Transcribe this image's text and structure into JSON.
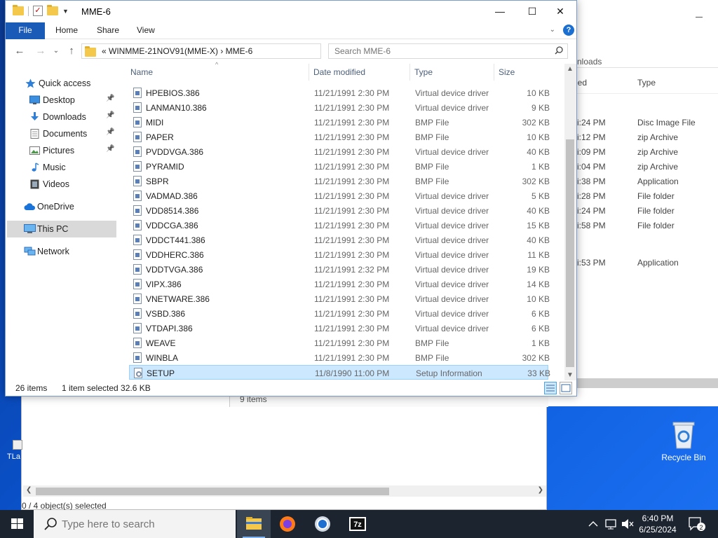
{
  "window": {
    "title": "MME-6",
    "controls": {
      "minimize": "—",
      "maximize": "☐",
      "close": "✕"
    }
  },
  "ribbon": {
    "tabs": [
      "File",
      "Home",
      "Share",
      "View"
    ],
    "help": "?"
  },
  "nav": {
    "back": "←",
    "forward": "→",
    "recent": "⌄",
    "up": "↑",
    "breadcrumb": "«  WINMME-21NOV91(MME-X)  ›  MME-6",
    "refresh": "↻",
    "search_placeholder": "Search MME-6"
  },
  "navpane": {
    "items": [
      {
        "label": "Quick access",
        "icon": "star-icon"
      },
      {
        "label": "Desktop",
        "icon": "desktop-icon",
        "pinned": true
      },
      {
        "label": "Downloads",
        "icon": "download-icon",
        "pinned": true
      },
      {
        "label": "Documents",
        "icon": "documents-icon",
        "pinned": true
      },
      {
        "label": "Pictures",
        "icon": "pictures-icon",
        "pinned": true
      },
      {
        "label": "Music",
        "icon": "music-icon"
      },
      {
        "label": "Videos",
        "icon": "videos-icon"
      },
      {
        "label": "OneDrive",
        "icon": "cloud-icon"
      },
      {
        "label": "This PC",
        "icon": "computer-icon",
        "selected": true
      },
      {
        "label": "Network",
        "icon": "network-icon"
      }
    ]
  },
  "columns": {
    "name": "Name",
    "date": "Date modified",
    "type": "Type",
    "size": "Size"
  },
  "files": [
    {
      "name": "HPEBIOS.386",
      "date": "11/21/1991 2:30 PM",
      "type": "Virtual device driver",
      "size": "10 KB"
    },
    {
      "name": "LANMAN10.386",
      "date": "11/21/1991 2:30 PM",
      "type": "Virtual device driver",
      "size": "9 KB"
    },
    {
      "name": "MIDI",
      "date": "11/21/1991 2:30 PM",
      "type": "BMP File",
      "size": "302 KB"
    },
    {
      "name": "PAPER",
      "date": "11/21/1991 2:30 PM",
      "type": "BMP File",
      "size": "10 KB"
    },
    {
      "name": "PVDDVGA.386",
      "date": "11/21/1991 2:30 PM",
      "type": "Virtual device driver",
      "size": "40 KB"
    },
    {
      "name": "PYRAMID",
      "date": "11/21/1991 2:30 PM",
      "type": "BMP File",
      "size": "1 KB"
    },
    {
      "name": "SBPR",
      "date": "11/21/1991 2:30 PM",
      "type": "BMP File",
      "size": "302 KB"
    },
    {
      "name": "VADMAD.386",
      "date": "11/21/1991 2:30 PM",
      "type": "Virtual device driver",
      "size": "5 KB"
    },
    {
      "name": "VDD8514.386",
      "date": "11/21/1991 2:30 PM",
      "type": "Virtual device driver",
      "size": "40 KB"
    },
    {
      "name": "VDDCGA.386",
      "date": "11/21/1991 2:30 PM",
      "type": "Virtual device driver",
      "size": "15 KB"
    },
    {
      "name": "VDDCT441.386",
      "date": "11/21/1991 2:30 PM",
      "type": "Virtual device driver",
      "size": "40 KB"
    },
    {
      "name": "VDDHERC.386",
      "date": "11/21/1991 2:30 PM",
      "type": "Virtual device driver",
      "size": "11 KB"
    },
    {
      "name": "VDDTVGA.386",
      "date": "11/21/1991 2:32 PM",
      "type": "Virtual device driver",
      "size": "19 KB"
    },
    {
      "name": "VIPX.386",
      "date": "11/21/1991 2:30 PM",
      "type": "Virtual device driver",
      "size": "14 KB"
    },
    {
      "name": "VNETWARE.386",
      "date": "11/21/1991 2:30 PM",
      "type": "Virtual device driver",
      "size": "10 KB"
    },
    {
      "name": "VSBD.386",
      "date": "11/21/1991 2:30 PM",
      "type": "Virtual device driver",
      "size": "6 KB"
    },
    {
      "name": "VTDAPI.386",
      "date": "11/21/1991 2:30 PM",
      "type": "Virtual device driver",
      "size": "6 KB"
    },
    {
      "name": "WEAVE",
      "date": "11/21/1991 2:30 PM",
      "type": "BMP File",
      "size": "1 KB"
    },
    {
      "name": "WINBLA",
      "date": "11/21/1991 2:30 PM",
      "type": "BMP File",
      "size": "302 KB"
    },
    {
      "name": "SETUP",
      "date": "11/8/1990 11:00 PM",
      "type": "Setup Information",
      "size": "33 KB",
      "selected": true
    }
  ],
  "status": {
    "count": "26 items",
    "selection": "1 item selected  32.6 KB"
  },
  "bg_right": {
    "address": "nloads",
    "col_date": "ied",
    "col_type": "Type",
    "rows": [
      {
        "time": "i:24 PM",
        "type": "Disc Image File"
      },
      {
        "time": "i:12 PM",
        "type": "zip Archive"
      },
      {
        "time": "i:09 PM",
        "type": "zip Archive"
      },
      {
        "time": "i:04 PM",
        "type": "zip Archive"
      },
      {
        "time": "i:38 PM",
        "type": "Application"
      },
      {
        "time": "i:28 PM",
        "type": "File folder"
      },
      {
        "time": "i:24 PM",
        "type": "File folder"
      },
      {
        "time": "i:58 PM",
        "type": "File folder"
      },
      {
        "time": "i:53 PM",
        "type": "Application"
      }
    ]
  },
  "bg_bottom": {
    "items": "9 items",
    "status": "0 / 4 object(s) selected"
  },
  "desktop": {
    "left_icon_label": "TLa",
    "recycle_bin": "Recycle Bin"
  },
  "taskbar": {
    "search_placeholder": "Type here to search",
    "apps": [
      "file-explorer-icon",
      "firefox-icon",
      "chrome-icon",
      "7zip-icon"
    ],
    "seven_zip_label": "7z",
    "time": "6:40 PM",
    "date": "6/25/2024",
    "notification_count": "2"
  }
}
